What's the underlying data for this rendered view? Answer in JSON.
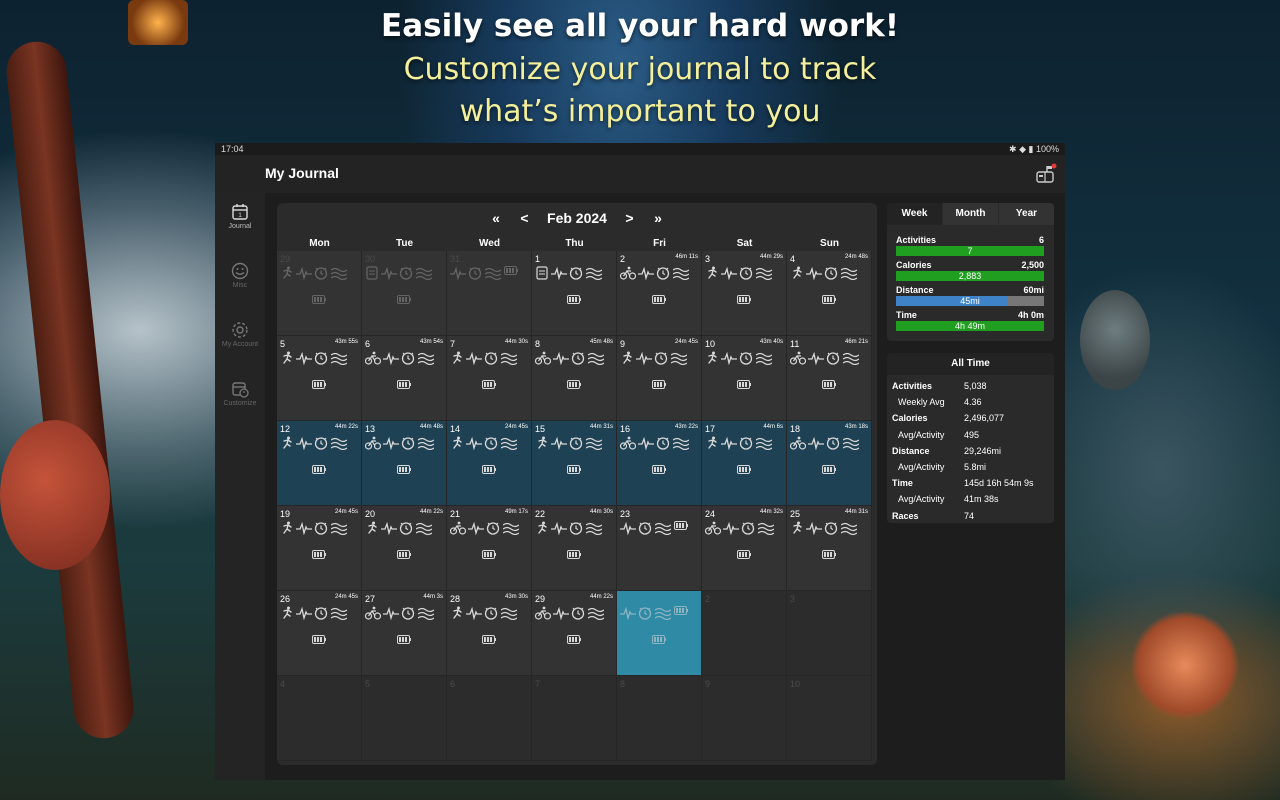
{
  "headline": {
    "line1": "Easily see all your hard work!",
    "line2": "Customize your journal to track",
    "line3": "what’s important to you"
  },
  "statusbar": {
    "time": "17:04",
    "battery": "100%"
  },
  "app": {
    "title": "My Journal"
  },
  "nav": [
    {
      "label": "Journal",
      "icon": "calendar-icon",
      "active": true
    },
    {
      "label": "Misc",
      "icon": "smiley-icon",
      "active": false
    },
    {
      "label": "My Account",
      "icon": "gear-icon",
      "active": false
    },
    {
      "label": "Customize",
      "icon": "calendar-clock-icon",
      "active": false
    }
  ],
  "calendar": {
    "month": "Feb 2024",
    "nav": {
      "prev_year": "«",
      "prev_month": "<",
      "next_month": ">",
      "next_year": "»"
    },
    "weekdays": [
      "Mon",
      "Tue",
      "Wed",
      "Thu",
      "Fri",
      "Sat",
      "Sun"
    ],
    "days": [
      {
        "day": "29",
        "dur": "",
        "sport": "run",
        "other": true
      },
      {
        "day": "30",
        "dur": "",
        "sport": "note",
        "other": true
      },
      {
        "day": "31",
        "dur": "",
        "sport": "none",
        "other": true
      },
      {
        "day": "1",
        "dur": "",
        "sport": "note"
      },
      {
        "day": "2",
        "dur": "46m 11s",
        "sport": "bike"
      },
      {
        "day": "3",
        "dur": "44m 29s",
        "sport": "run"
      },
      {
        "day": "4",
        "dur": "24m 48s",
        "sport": "run"
      },
      {
        "day": "5",
        "dur": "43m 55s",
        "sport": "run"
      },
      {
        "day": "6",
        "dur": "43m 54s",
        "sport": "bike"
      },
      {
        "day": "7",
        "dur": "44m 30s",
        "sport": "run"
      },
      {
        "day": "8",
        "dur": "45m 48s",
        "sport": "bike"
      },
      {
        "day": "9",
        "dur": "24m 45s",
        "sport": "run"
      },
      {
        "day": "10",
        "dur": "43m 40s",
        "sport": "run"
      },
      {
        "day": "11",
        "dur": "46m 21s",
        "sport": "bike"
      },
      {
        "day": "12",
        "dur": "44m 22s",
        "sport": "run",
        "hl": true
      },
      {
        "day": "13",
        "dur": "44m 48s",
        "sport": "bike",
        "hl": true
      },
      {
        "day": "14",
        "dur": "24m 45s",
        "sport": "run",
        "hl": true
      },
      {
        "day": "15",
        "dur": "44m 31s",
        "sport": "run",
        "hl": true
      },
      {
        "day": "16",
        "dur": "43m 22s",
        "sport": "bike",
        "hl": true
      },
      {
        "day": "17",
        "dur": "44m 6s",
        "sport": "run",
        "hl": true
      },
      {
        "day": "18",
        "dur": "43m 18s",
        "sport": "bike",
        "hl": true
      },
      {
        "day": "19",
        "dur": "24m 45s",
        "sport": "run"
      },
      {
        "day": "20",
        "dur": "44m 22s",
        "sport": "run"
      },
      {
        "day": "21",
        "dur": "49m 17s",
        "sport": "bike"
      },
      {
        "day": "22",
        "dur": "44m 30s",
        "sport": "run"
      },
      {
        "day": "23",
        "dur": "",
        "sport": "none"
      },
      {
        "day": "24",
        "dur": "44m 32s",
        "sport": "bike"
      },
      {
        "day": "25",
        "dur": "44m 31s",
        "sport": "run"
      },
      {
        "day": "26",
        "dur": "24m 45s",
        "sport": "run"
      },
      {
        "day": "27",
        "dur": "44m 3s",
        "sport": "bike"
      },
      {
        "day": "28",
        "dur": "43m 30s",
        "sport": "run"
      },
      {
        "day": "29",
        "dur": "44m 22s",
        "sport": "bike"
      },
      {
        "day": "",
        "dur": "",
        "sport": "none",
        "today": true
      },
      {
        "day": "2",
        "dur": "",
        "sport": "empty",
        "other": true
      },
      {
        "day": "3",
        "dur": "",
        "sport": "empty",
        "other": true
      },
      {
        "day": "4",
        "dur": "",
        "sport": "empty",
        "other": true
      },
      {
        "day": "5",
        "dur": "",
        "sport": "empty",
        "other": true
      },
      {
        "day": "6",
        "dur": "",
        "sport": "empty",
        "other": true
      },
      {
        "day": "7",
        "dur": "",
        "sport": "empty",
        "other": true
      },
      {
        "day": "8",
        "dur": "",
        "sport": "empty",
        "other": true
      },
      {
        "day": "9",
        "dur": "",
        "sport": "empty",
        "other": true
      },
      {
        "day": "10",
        "dur": "",
        "sport": "empty",
        "other": true
      }
    ]
  },
  "period": {
    "tabs": [
      "Week",
      "Month",
      "Year"
    ],
    "active_tab": "Week",
    "stats": [
      {
        "label": "Activities",
        "goal": "6",
        "value": "7",
        "fraction": 1.0,
        "color": "#1f9e1f"
      },
      {
        "label": "Calories",
        "goal": "2,500",
        "value": "2,883",
        "fraction": 1.0,
        "color": "#1f9e1f"
      },
      {
        "label": "Distance",
        "goal": "60mi",
        "value": "45mi",
        "fraction": 0.75,
        "color": "#3e82c8"
      },
      {
        "label": "Time",
        "goal": "4h 0m",
        "value": "4h 49m",
        "fraction": 1.0,
        "color": "#1f9e1f"
      }
    ]
  },
  "alltime": {
    "title": "All Time",
    "rows": [
      {
        "k": "Activities",
        "v": "5,038",
        "sub": false
      },
      {
        "k": "Weekly Avg",
        "v": "4.36",
        "sub": true
      },
      {
        "k": "Calories",
        "v": "2,496,077",
        "sub": false
      },
      {
        "k": "Avg/Activity",
        "v": "495",
        "sub": true
      },
      {
        "k": "Distance",
        "v": "29,246mi",
        "sub": false
      },
      {
        "k": "Avg/Activity",
        "v": "5.8mi",
        "sub": true
      },
      {
        "k": "Time",
        "v": "145d 16h 54m 9s",
        "sub": false
      },
      {
        "k": "Avg/Activity",
        "v": "41m 38s",
        "sub": true
      },
      {
        "k": "Races",
        "v": "74",
        "sub": false
      }
    ]
  }
}
